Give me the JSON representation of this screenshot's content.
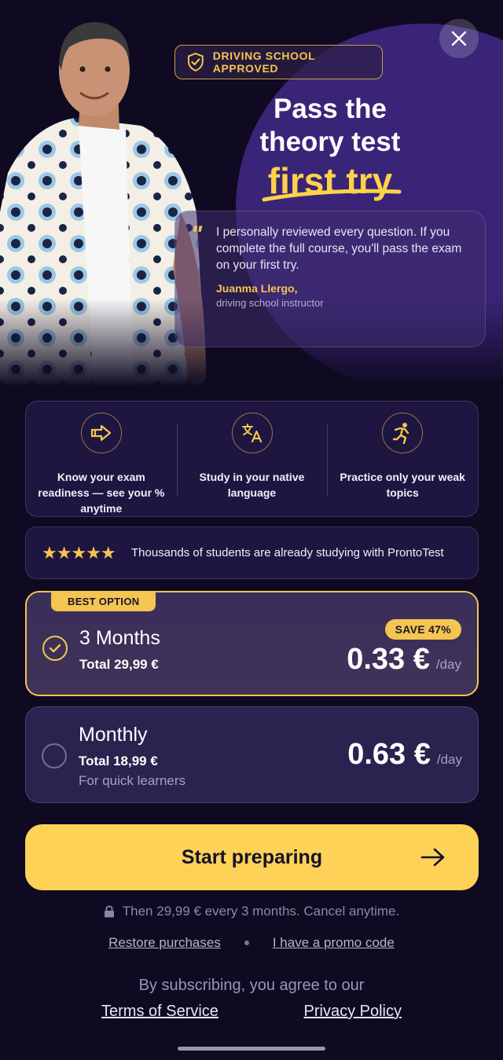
{
  "badge": {
    "label": "DRIVING SCHOOL APPROVED",
    "icon": "shield-check-icon"
  },
  "headline": {
    "line1": "Pass the",
    "line2": "theory test",
    "accent": "first try"
  },
  "quote": {
    "text": "I personally reviewed every question. If you complete the full course, you'll pass the exam on your first try.",
    "author": "Juanma Llergo,",
    "role": "driving school instructor"
  },
  "features": [
    {
      "icon": "arrow-right-icon",
      "label": "Know your exam readiness — see your % anytime"
    },
    {
      "icon": "translate-icon",
      "label": "Study in your native language"
    },
    {
      "icon": "runner-icon",
      "label": "Practice only your weak topics"
    }
  ],
  "social_proof": {
    "stars": "★★★★★",
    "text": "Thousands of students are already studying with ProntoTest"
  },
  "plans": [
    {
      "tag": "BEST OPTION",
      "name": "3 Months",
      "total": "Total 29,99 €",
      "save": "SAVE 47%",
      "price": "0.33 €",
      "per": "/day",
      "selected": true
    },
    {
      "name": "Monthly",
      "total": "Total 18,99 €",
      "note": "For quick learners",
      "price": "0.63 €",
      "per": "/day",
      "selected": false
    }
  ],
  "cta": {
    "label": "Start preparing"
  },
  "renewal_text": "Then 29,99 € every 3 months. Cancel anytime.",
  "links": {
    "restore": "Restore purchases",
    "promo": "I have a promo code"
  },
  "legal": {
    "agree": "By subscribing, you agree to our",
    "terms": "Terms of Service",
    "privacy": "Privacy Policy"
  },
  "colors": {
    "accent": "#f4c550",
    "background": "#0f0a22",
    "cta": "#fdd256"
  }
}
